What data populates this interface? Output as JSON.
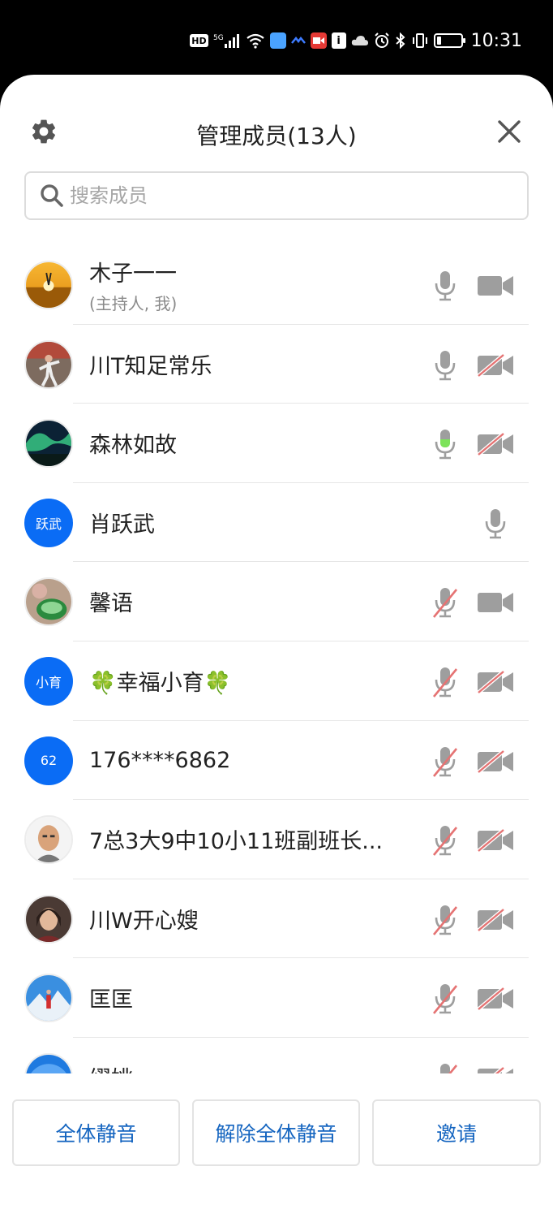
{
  "status_bar": {
    "hd": "HD",
    "network": "5G",
    "app_icon_4": "i",
    "battery_level": 0.2,
    "time": "10:31"
  },
  "header": {
    "title": "管理成员(13人)"
  },
  "search": {
    "placeholder": "搜索成员"
  },
  "members": [
    {
      "name": "木子一一",
      "subtitle": "(主持人, 我)",
      "avatar": "sunset-photo",
      "mic": "on",
      "cam": "on"
    },
    {
      "name": "川T知足常乐",
      "avatar": "dance-photo",
      "mic": "on",
      "cam": "off"
    },
    {
      "name": "森林如故",
      "avatar": "aurora-photo",
      "mic": "speaking",
      "cam": "off"
    },
    {
      "name": "肖跃武",
      "avatar_text": "跃武",
      "mic": "on",
      "cam": "none"
    },
    {
      "name": "馨语",
      "avatar": "tea-photo",
      "mic": "off",
      "cam": "on"
    },
    {
      "name": "🍀幸福小育🍀",
      "avatar_text": "小育",
      "mic": "off",
      "cam": "off"
    },
    {
      "name": "176****6862",
      "avatar_text": "62",
      "mic": "off",
      "cam": "off"
    },
    {
      "name": "7总3大9中10小11班副班长...",
      "avatar": "man-photo",
      "mic": "off",
      "cam": "off"
    },
    {
      "name": "川W开心嫂",
      "avatar": "woman-photo",
      "mic": "off",
      "cam": "off"
    },
    {
      "name": "匡匡",
      "avatar": "mountain-photo",
      "mic": "off",
      "cam": "off"
    },
    {
      "name": "缪姚",
      "avatar": "sky-photo",
      "mic": "off",
      "cam": "off"
    }
  ],
  "actions": {
    "mute_all": "全体静音",
    "unmute_all": "解除全体静音",
    "invite": "邀请"
  },
  "colors": {
    "accent": "#1565c0",
    "avatar_blue": "#0a6cf5",
    "icon_gray": "#9e9e9e",
    "muted_red": "#e57373",
    "speaking_green": "#7ce35a"
  }
}
